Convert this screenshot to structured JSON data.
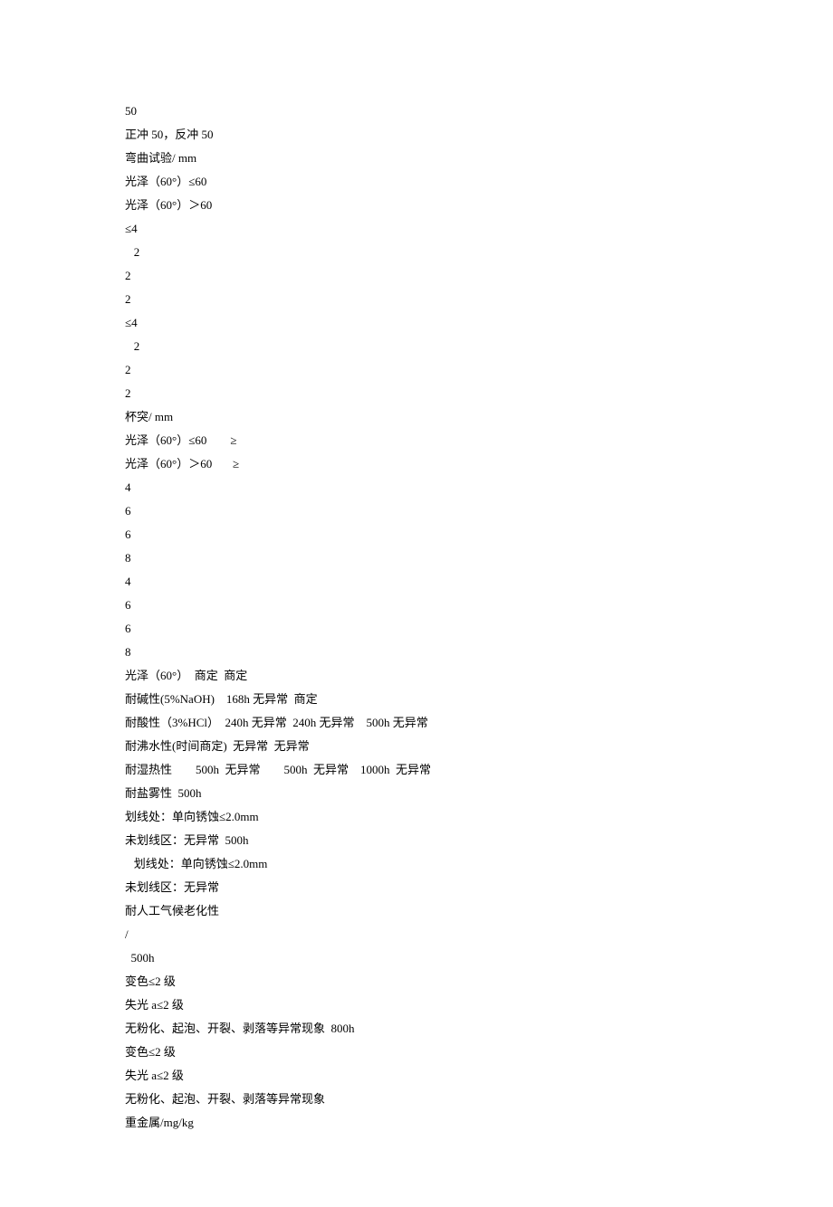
{
  "lines": [
    "50",
    "正冲 50，反冲 50",
    "弯曲试验/ mm",
    "光泽（60°）≤60",
    "光泽（60°）＞60",
    "≤4",
    "   2",
    "2",
    "2",
    "≤4",
    "   2",
    "2",
    "2",
    "杯突/ mm",
    "光泽（60°）≤60        ≥",
    "光泽（60°）＞60       ≥",
    "4",
    "6",
    "6",
    "8",
    "4",
    "6",
    "6",
    "8",
    "光泽（60°）  商定  商定",
    "耐碱性(5%NaOH)    168h 无异常  商定",
    "耐酸性（3%HCl）  240h 无异常  240h 无异常    500h 无异常",
    "耐沸水性(时间商定)  无异常  无异常",
    "耐湿热性        500h  无异常        500h  无异常    1000h  无异常",
    "耐盐雾性  500h",
    "划线处：单向锈蚀≤2.0mm",
    "未划线区：无异常  500h",
    "   划线处：单向锈蚀≤2.0mm",
    "未划线区：无异常",
    "耐人工气候老化性",
    "/",
    "  500h",
    "变色≤2 级",
    "失光 a≤2 级",
    "无粉化、起泡、开裂、剥落等异常现象  800h",
    "变色≤2 级",
    "失光 a≤2 级",
    "无粉化、起泡、开裂、剥落等异常现象",
    "重金属/mg/kg"
  ]
}
